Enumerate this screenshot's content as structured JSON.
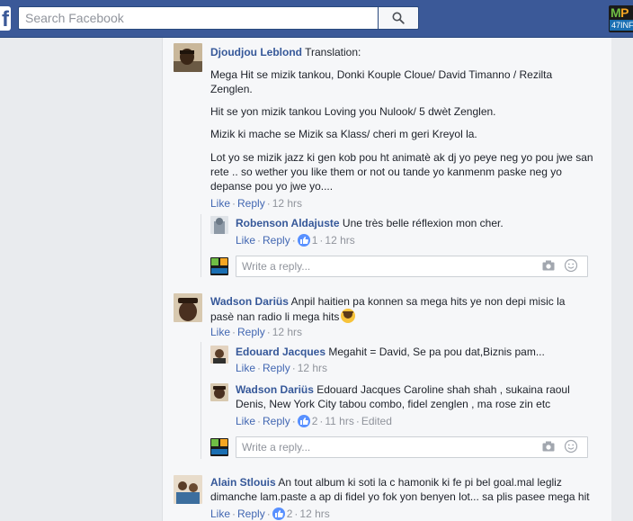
{
  "header": {
    "logo_letter": "f",
    "search_placeholder": "Search Facebook",
    "brand_logo_top_m": "M",
    "brand_logo_top_p": "P",
    "brand_logo_bottom": "47INF"
  },
  "comments": [
    {
      "name": "Djoudjou Leblond",
      "paragraphs": [
        "Translation:",
        "Mega Hit se mizik tankou, Donki Kouple Cloue/ David Timanno / Rezilta Zenglen.",
        "Hit se yon mizik tankou Loving you Nulook/ 5 dwèt Zenglen.",
        "Mizik ki mache se Mizik sa Klass/ cheri m geri Kreyol la.",
        "Lot yo se mizik jazz ki gen kob pou ht animatè ak dj yo peye neg yo pou jwe san rete .. so wether you like them or not ou tande yo kanmenm paske neg yo depanse pou yo jwe yo...."
      ],
      "like_label": "Like",
      "reply_label": "Reply",
      "time": "12 hrs",
      "replies": [
        {
          "name": "Robenson Aldajuste",
          "text": "Une très belle réflexion mon cher.",
          "like_label": "Like",
          "reply_label": "Reply",
          "likes": "1",
          "time": "12 hrs"
        }
      ],
      "reply_placeholder": "Write a reply..."
    },
    {
      "name": "Wadson Dariüs",
      "text": "Anpil haitien pa konnen sa mega hits ye non depi misic la pasè nan radio li mega hits",
      "like_label": "Like",
      "reply_label": "Reply",
      "time": "12 hrs",
      "replies": [
        {
          "name": "Edouard Jacques",
          "text": "Megahit = David, Se pa pou dat,Biznis pam...",
          "like_label": "Like",
          "reply_label": "Reply",
          "time": "12 hrs"
        },
        {
          "name": "Wadson Dariüs",
          "text": "Edouard Jacques Caroline shah shah , sukaina raoul Denis, New York City tabou combo, fidel zenglen , ma rose zin etc",
          "like_label": "Like",
          "reply_label": "Reply",
          "likes": "2",
          "time": "11 hrs",
          "edited": "Edited"
        }
      ],
      "reply_placeholder": "Write a reply..."
    },
    {
      "name": "Alain Stlouis",
      "text": "An tout album ki soti la c hamonik ki fe pi bel goal.mal legliz dimanche lam.paste a ap di fidel yo fok yon benyen lot... sa plis pasee mega hit",
      "like_label": "Like",
      "reply_label": "Reply",
      "likes": "2",
      "time": "12 hrs"
    }
  ],
  "colors": {
    "topbar": "#3b5998",
    "link": "#365899",
    "action_link": "#4267b2",
    "meta_gray": "#90949c",
    "card_bg": "#f6f7f9",
    "page_bg": "#e9ebee"
  }
}
